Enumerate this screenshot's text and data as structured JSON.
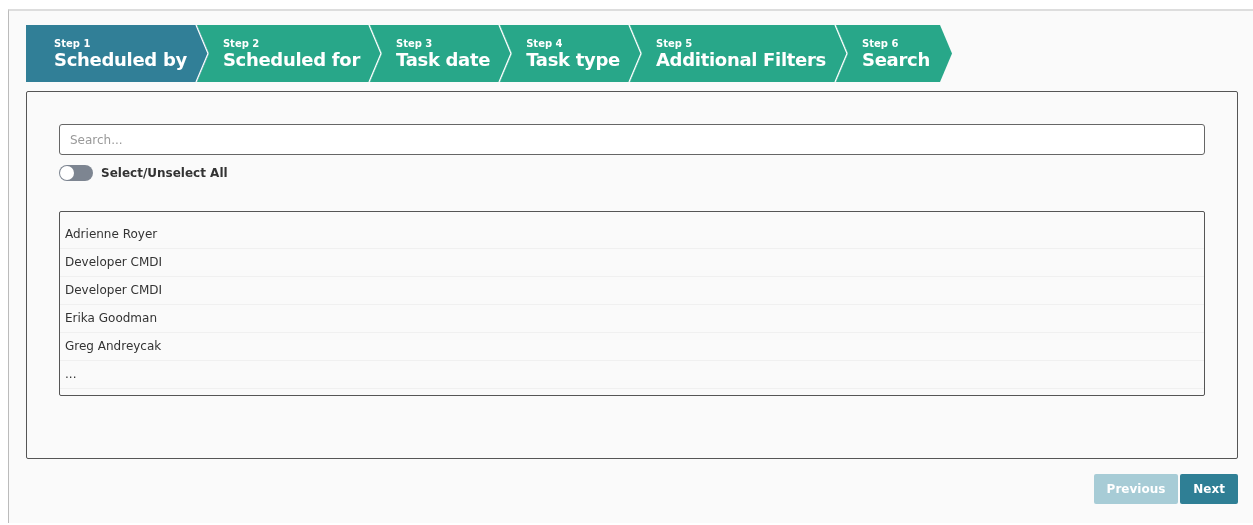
{
  "steps": [
    {
      "step": "Step 1",
      "label": "Scheduled by",
      "selected": true
    },
    {
      "step": "Step 2",
      "label": "Scheduled for",
      "selected": false
    },
    {
      "step": "Step 3",
      "label": "Task date",
      "selected": false
    },
    {
      "step": "Step 4",
      "label": "Task type",
      "selected": false
    },
    {
      "step": "Step 5",
      "label": "Additional Filters",
      "selected": false
    },
    {
      "step": "Step 6",
      "label": "Search",
      "selected": false
    }
  ],
  "search": {
    "placeholder": "Search..."
  },
  "select_all": {
    "label": "Select/Unselect All",
    "on": false
  },
  "list": [
    "Adrienne Royer",
    "Developer CMDI",
    "Developer CMDI",
    "Erika Goodman",
    "Greg Andreycak",
    "..."
  ],
  "buttons": [
    {
      "label": "Previous",
      "disabled": true
    },
    {
      "label": "Next",
      "disabled": false
    }
  ]
}
